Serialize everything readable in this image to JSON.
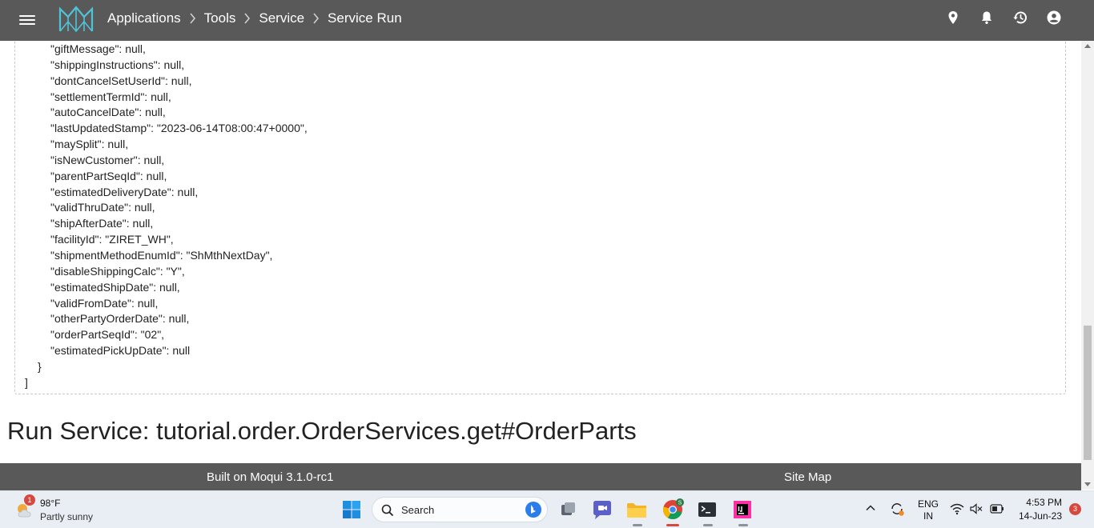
{
  "header": {
    "breadcrumbs": [
      "Applications",
      "Tools",
      "Service",
      "Service Run"
    ]
  },
  "json_output": {
    "lines": [
      "    \"giftMessage\": null,",
      "    \"shippingInstructions\": null,",
      "    \"dontCancelSetUserId\": null,",
      "    \"settlementTermId\": null,",
      "    \"autoCancelDate\": null,",
      "    \"lastUpdatedStamp\": \"2023-06-14T08:00:47+0000\",",
      "    \"maySplit\": null,",
      "    \"isNewCustomer\": null,",
      "    \"parentPartSeqId\": null,",
      "    \"estimatedDeliveryDate\": null,",
      "    \"validThruDate\": null,",
      "    \"shipAfterDate\": null,",
      "    \"facilityId\": \"ZIRET_WH\",",
      "    \"shipmentMethodEnumId\": \"ShMthNextDay\",",
      "    \"disableShippingCalc\": \"Y\",",
      "    \"estimatedShipDate\": null,",
      "    \"validFromDate\": null,",
      "    \"otherPartyOrderDate\": null,",
      "    \"orderPartSeqId\": \"02\",",
      "    \"estimatedPickUpDate\": null",
      "  }",
      "]"
    ]
  },
  "main": {
    "run_title": "Run Service: tutorial.order.OrderServices.get#OrderParts"
  },
  "footer": {
    "built_on": "Built on Moqui 3.1.0-rc1",
    "site_map": "Site Map"
  },
  "taskbar": {
    "weather_temp": "98°F",
    "weather_condition": "Partly sunny",
    "weather_badge": "1",
    "search_label": "Search",
    "language": "ENG",
    "region": "IN",
    "time": "4:53 PM",
    "date": "14-Jun-23",
    "notification_count": "3",
    "chrome_badge": "S"
  },
  "colors": {
    "appbar": "#595959",
    "taskbar": "#e9eef4",
    "logo": "#4fc3d9"
  }
}
